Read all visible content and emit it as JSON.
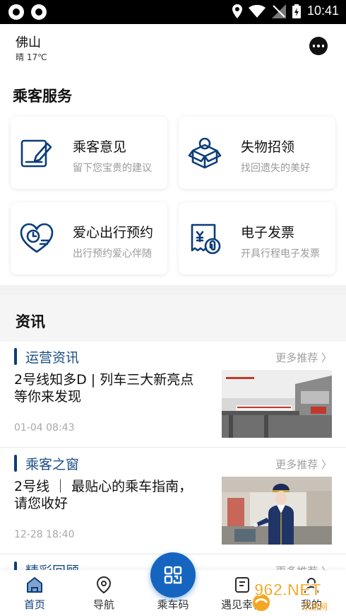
{
  "status_bar": {
    "time": "10:41"
  },
  "header": {
    "city": "佛山",
    "weather": "晴 17℃"
  },
  "service_section": {
    "title": "乘客服务",
    "cards": [
      {
        "title": "乘客意见",
        "subtitle": "留下您宝贵的建议",
        "icon": "feedback-icon"
      },
      {
        "title": "失物招领",
        "subtitle": "找回遗失的美好",
        "icon": "lost-found-icon"
      },
      {
        "title": "爱心出行预约",
        "subtitle": "出行预约爱心伴随",
        "icon": "heart-clock-icon"
      },
      {
        "title": "电子发票",
        "subtitle": "开具行程电子发票",
        "icon": "invoice-icon"
      }
    ]
  },
  "news_section": {
    "title": "资讯",
    "items": [
      {
        "category": "运营资讯",
        "more": "更多推荐",
        "title": "2号线知多D | 列车三大新亮点等你来发现",
        "time": "01-04 08:43"
      },
      {
        "category": "乘客之窗",
        "more": "更多推荐",
        "title": "2号线 ｜ 最贴心的乘车指南，请您收好",
        "time": "12-28 18:40"
      },
      {
        "category": "精彩回顾",
        "more": "更多推荐"
      }
    ]
  },
  "tabbar": {
    "tabs": [
      {
        "label": "首页",
        "icon": "home-icon"
      },
      {
        "label": "导航",
        "icon": "location-icon"
      },
      {
        "label": "乘车码",
        "icon": "qr-code-icon"
      },
      {
        "label": "遇见幸福",
        "icon": "notebook-icon"
      },
      {
        "label": "我的",
        "icon": "user-icon"
      }
    ]
  },
  "watermark": {
    "text": "962.NET",
    "subtext": "乐游网"
  },
  "colors": {
    "brand": "#0b3d78",
    "fab": "#1565c0"
  }
}
